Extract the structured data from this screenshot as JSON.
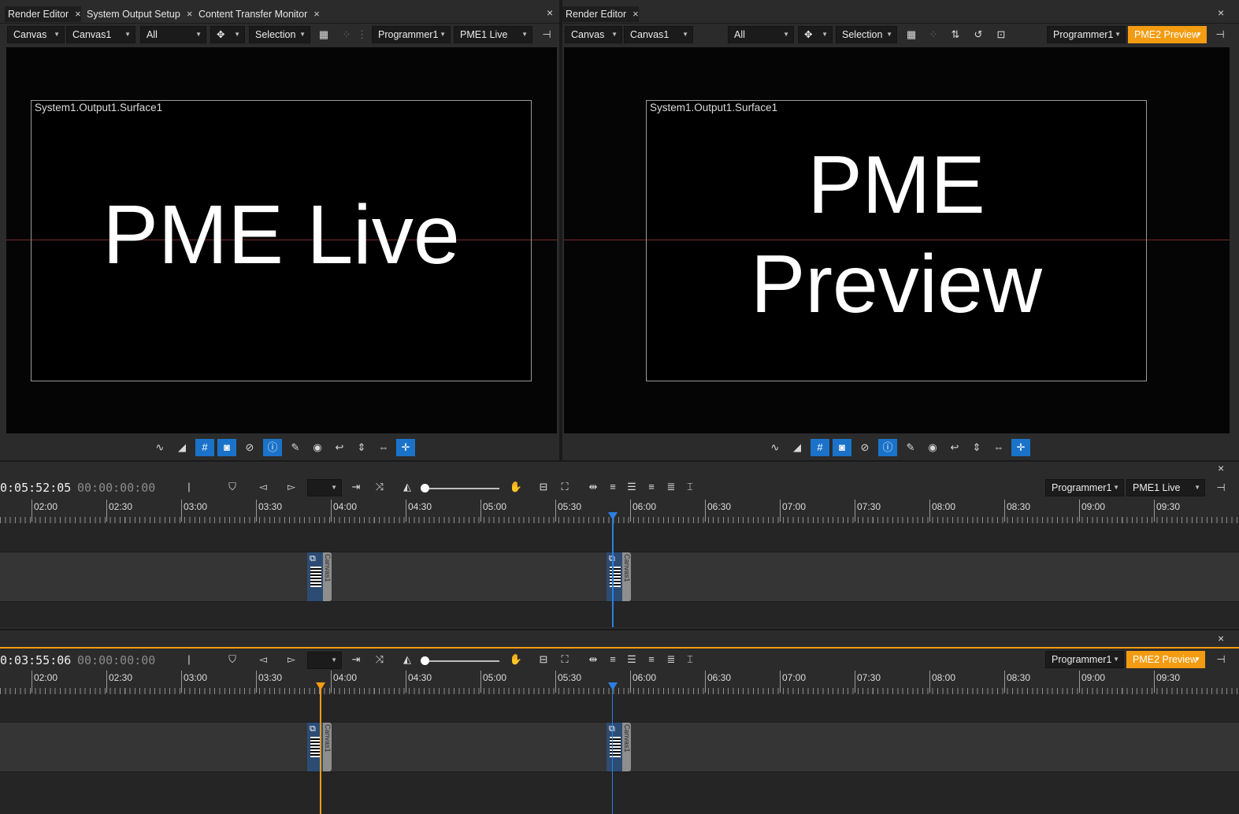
{
  "tabs_left": [
    {
      "label": "Render Editor"
    },
    {
      "label": "System Output Setup"
    },
    {
      "label": "Content Transfer Monitor"
    }
  ],
  "tabs_right": [
    {
      "label": "Render Editor"
    }
  ],
  "close_glyph": "×",
  "left_toolbar": {
    "canvas_type": "Canvas",
    "canvas_name": "Canvas1",
    "filter": "All",
    "mode": "Selection",
    "programmer": "Programmer1",
    "playback": "PME1 Live"
  },
  "right_toolbar": {
    "canvas_type": "Canvas",
    "canvas_name": "Canvas1",
    "filter": "All",
    "mode": "Selection",
    "programmer": "Programmer1",
    "playback": "PME2 Preview"
  },
  "left_view": {
    "surface_label": "System1.Output1.Surface1",
    "content_text": "PME Live"
  },
  "right_view": {
    "surface_label": "System1.Output1.Surface1",
    "content_line1": "PME",
    "content_line2": "Preview"
  },
  "timeline1": {
    "timecode": "0:05:52:05",
    "offset": "00:00:00:00",
    "programmer": "Programmer1",
    "playback": "PME1 Live",
    "cue_label": "Canvas1"
  },
  "timeline2": {
    "timecode": "0:03:55:06",
    "offset": "00:00:00:00",
    "programmer": "Programmer1",
    "playback": "PME2 Preview",
    "cue_label": "Canvas1"
  },
  "ruler_labels": [
    "02:00",
    "02:30",
    "03:00",
    "03:30",
    "04:00",
    "04:30",
    "05:00",
    "05:30",
    "06:00",
    "06:30",
    "07:00",
    "07:30",
    "08:00",
    "08:30",
    "09:00",
    "09:30"
  ],
  "colors": {
    "accent_orange": "#f39c12",
    "accent_blue": "#1a73c9"
  }
}
